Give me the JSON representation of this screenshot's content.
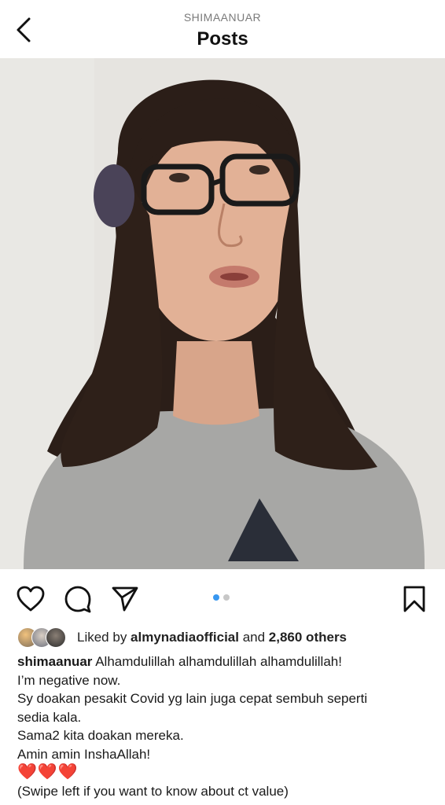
{
  "header": {
    "username": "SHIMAANUAR",
    "title": "Posts"
  },
  "post": {
    "carousel_total": 2,
    "carousel_index": 1,
    "liked_by_prefix": "Liked by ",
    "liked_by_user": "almynadiaofficial",
    "likes_conjunction": " and ",
    "likes_others": "2,860 others",
    "caption_user": "shimaanuar",
    "caption_first": " Alhamdulillah alhamdulillah alhamdulillah!",
    "caption_lines": [
      "I’m negative now.",
      "Sy doakan pesakit Covid yg lain juga cepat sembuh seperti",
      "sedia kala.",
      "Sama2 kita doakan mereka.",
      "Amin amin InshaAllah!",
      "❤️❤️❤️",
      "(Swipe left if you want to know about ct value)"
    ]
  },
  "icons": {
    "back": "chevron-left-icon",
    "like": "heart-outline-icon",
    "comment": "comment-bubble-icon",
    "share": "paper-plane-icon",
    "save": "bookmark-icon"
  },
  "colors": {
    "accent": "#3897f0",
    "heart": "#d0202b"
  }
}
